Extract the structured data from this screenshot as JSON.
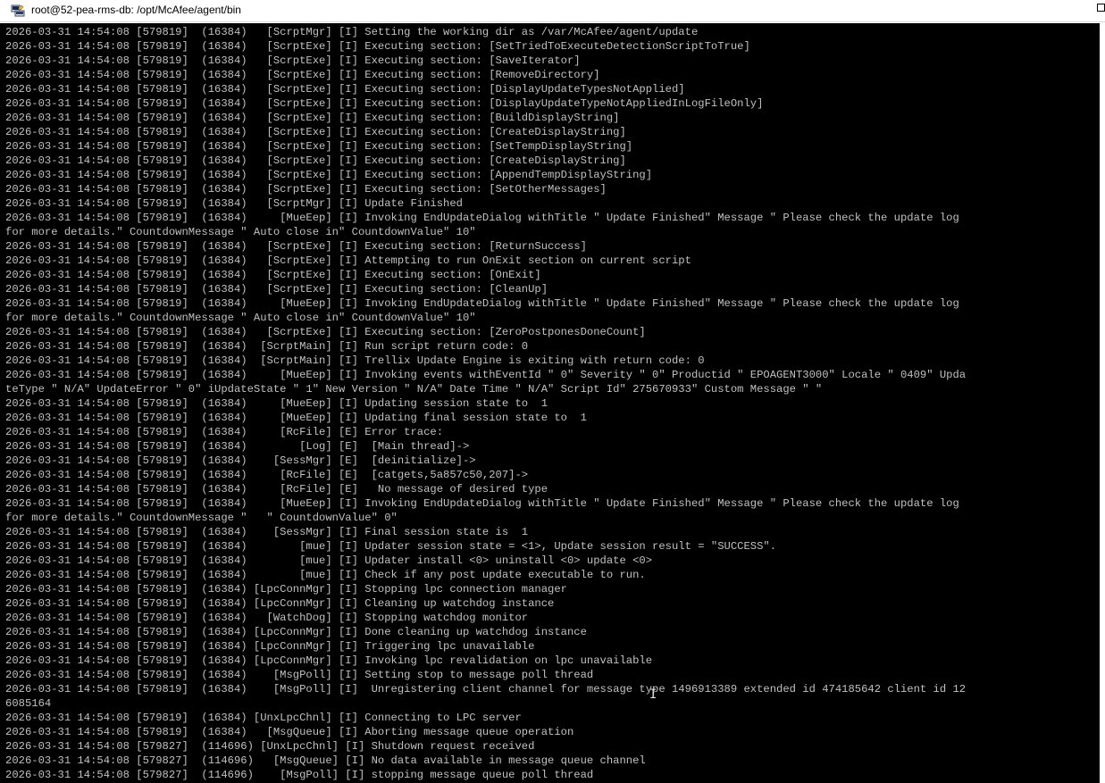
{
  "window": {
    "title": "root@52-pea-rms-db: /opt/McAfee/agent/bin",
    "icon": "putty-terminal-icon",
    "controls": {
      "restore_icon": "restore-icon"
    },
    "colors": {
      "terminal_bg": "#000000",
      "terminal_fg": "#c0c0c0",
      "titlebar_bg": "#ffffff"
    }
  },
  "terminal": {
    "lines": [
      "2026-03-31 14:54:08 [579819]  (16384)   [ScrptMgr] [I] Setting the working dir as /var/McAfee/agent/update",
      "2026-03-31 14:54:08 [579819]  (16384)   [ScrptExe] [I] Executing section: [SetTriedToExecuteDetectionScriptToTrue]",
      "2026-03-31 14:54:08 [579819]  (16384)   [ScrptExe] [I] Executing section: [SaveIterator]",
      "2026-03-31 14:54:08 [579819]  (16384)   [ScrptExe] [I] Executing section: [RemoveDirectory]",
      "2026-03-31 14:54:08 [579819]  (16384)   [ScrptExe] [I] Executing section: [DisplayUpdateTypesNotApplied]",
      "2026-03-31 14:54:08 [579819]  (16384)   [ScrptExe] [I] Executing section: [DisplayUpdateTypeNotAppliedInLogFileOnly]",
      "2026-03-31 14:54:08 [579819]  (16384)   [ScrptExe] [I] Executing section: [BuildDisplayString]",
      "2026-03-31 14:54:08 [579819]  (16384)   [ScrptExe] [I] Executing section: [CreateDisplayString]",
      "2026-03-31 14:54:08 [579819]  (16384)   [ScrptExe] [I] Executing section: [SetTempDisplayString]",
      "2026-03-31 14:54:08 [579819]  (16384)   [ScrptExe] [I] Executing section: [CreateDisplayString]",
      "2026-03-31 14:54:08 [579819]  (16384)   [ScrptExe] [I] Executing section: [AppendTempDisplayString]",
      "2026-03-31 14:54:08 [579819]  (16384)   [ScrptExe] [I] Executing section: [SetOtherMessages]",
      "2026-03-31 14:54:08 [579819]  (16384)   [ScrptMgr] [I] Update Finished",
      "2026-03-31 14:54:08 [579819]  (16384)     [MueEep] [I] Invoking EndUpdateDialog withTitle \" Update Finished\" Message \" Please check the update log",
      "for more details.\" CountdownMessage \" Auto close in\" CountdownValue\" 10\"",
      "2026-03-31 14:54:08 [579819]  (16384)   [ScrptExe] [I] Executing section: [ReturnSuccess]",
      "2026-03-31 14:54:08 [579819]  (16384)   [ScrptExe] [I] Attempting to run OnExit section on current script",
      "2026-03-31 14:54:08 [579819]  (16384)   [ScrptExe] [I] Executing section: [OnExit]",
      "2026-03-31 14:54:08 [579819]  (16384)   [ScrptExe] [I] Executing section: [CleanUp]",
      "2026-03-31 14:54:08 [579819]  (16384)     [MueEep] [I] Invoking EndUpdateDialog withTitle \" Update Finished\" Message \" Please check the update log",
      "for more details.\" CountdownMessage \" Auto close in\" CountdownValue\" 10\"",
      "2026-03-31 14:54:08 [579819]  (16384)   [ScrptExe] [I] Executing section: [ZeroPostponesDoneCount]",
      "2026-03-31 14:54:08 [579819]  (16384)  [ScrptMain] [I] Run script return code: 0",
      "2026-03-31 14:54:08 [579819]  (16384)  [ScrptMain] [I] Trellix Update Engine is exiting with return code: 0",
      "2026-03-31 14:54:08 [579819]  (16384)     [MueEep] [I] Invoking events withEventId \" 0\" Severity \" 0\" Productid \" EPOAGENT3000\" Locale \" 0409\" Upda",
      "teType \" N/A\" UpdateError \" 0\" iUpdateState \" 1\" New Version \" N/A\" Date Time \" N/A\" Script Id\" 275670933\" Custom Message \" \"",
      "2026-03-31 14:54:08 [579819]  (16384)     [MueEep] [I] Updating session state to  1",
      "2026-03-31 14:54:08 [579819]  (16384)     [MueEep] [I] Updating final session state to  1",
      "2026-03-31 14:54:08 [579819]  (16384)     [RcFile] [E] Error trace:",
      "2026-03-31 14:54:08 [579819]  (16384)        [Log] [E]  [Main thread]->",
      "2026-03-31 14:54:08 [579819]  (16384)    [SessMgr] [E]  [deinitialize]->",
      "2026-03-31 14:54:08 [579819]  (16384)     [RcFile] [E]  [catgets,5a857c50,207]->",
      "2026-03-31 14:54:08 [579819]  (16384)     [RcFile] [E]   No message of desired type",
      "2026-03-31 14:54:08 [579819]  (16384)     [MueEep] [I] Invoking EndUpdateDialog withTitle \" Update Finished\" Message \" Please check the update log",
      "for more details.\" CountdownMessage \"   \" CountdownValue\" 0\"",
      "2026-03-31 14:54:08 [579819]  (16384)    [SessMgr] [I] Final session state is  1",
      "2026-03-31 14:54:08 [579819]  (16384)        [mue] [I] Updater session state = <1>, Update session result = \"SUCCESS\".",
      "2026-03-31 14:54:08 [579819]  (16384)        [mue] [I] Updater install <0> uninstall <0> update <0>",
      "2026-03-31 14:54:08 [579819]  (16384)        [mue] [I] Check if any post update executable to run.",
      "2026-03-31 14:54:08 [579819]  (16384) [LpcConnMgr] [I] Stopping lpc connection manager",
      "2026-03-31 14:54:08 [579819]  (16384) [LpcConnMgr] [I] Cleaning up watchdog instance",
      "2026-03-31 14:54:08 [579819]  (16384)   [WatchDog] [I] Stopping watchdog monitor",
      "2026-03-31 14:54:08 [579819]  (16384) [LpcConnMgr] [I] Done cleaning up watchdog instance",
      "2026-03-31 14:54:08 [579819]  (16384) [LpcConnMgr] [I] Triggering lpc unavailable",
      "2026-03-31 14:54:08 [579819]  (16384) [LpcConnMgr] [I] Invoking lpc revalidation on lpc unavailable",
      "2026-03-31 14:54:08 [579819]  (16384)    [MsgPoll] [I] Setting stop to message poll thread",
      "2026-03-31 14:54:08 [579819]  (16384)    [MsgPoll] [I]  Unregistering client channel for message type 1496913389 extended id 474185642 client id 12",
      "6085164",
      "2026-03-31 14:54:08 [579819]  (16384) [UnxLpcChnl] [I] Connecting to LPC server",
      "2026-03-31 14:54:08 [579819]  (16384)   [MsgQueue] [I] Aborting message queue operation",
      "2026-03-31 14:54:08 [579827]  (114696) [UnxLpcChnl] [I] Shutdown request received",
      "2026-03-31 14:54:08 [579827]  (114696)   [MsgQueue] [I] No data available in message queue channel",
      "2026-03-31 14:54:08 [579827]  (114696)    [MsgPoll] [I] stopping message queue poll thread"
    ]
  },
  "cursor": {
    "icon": "i-beam-cursor-icon",
    "glyph": "I"
  }
}
